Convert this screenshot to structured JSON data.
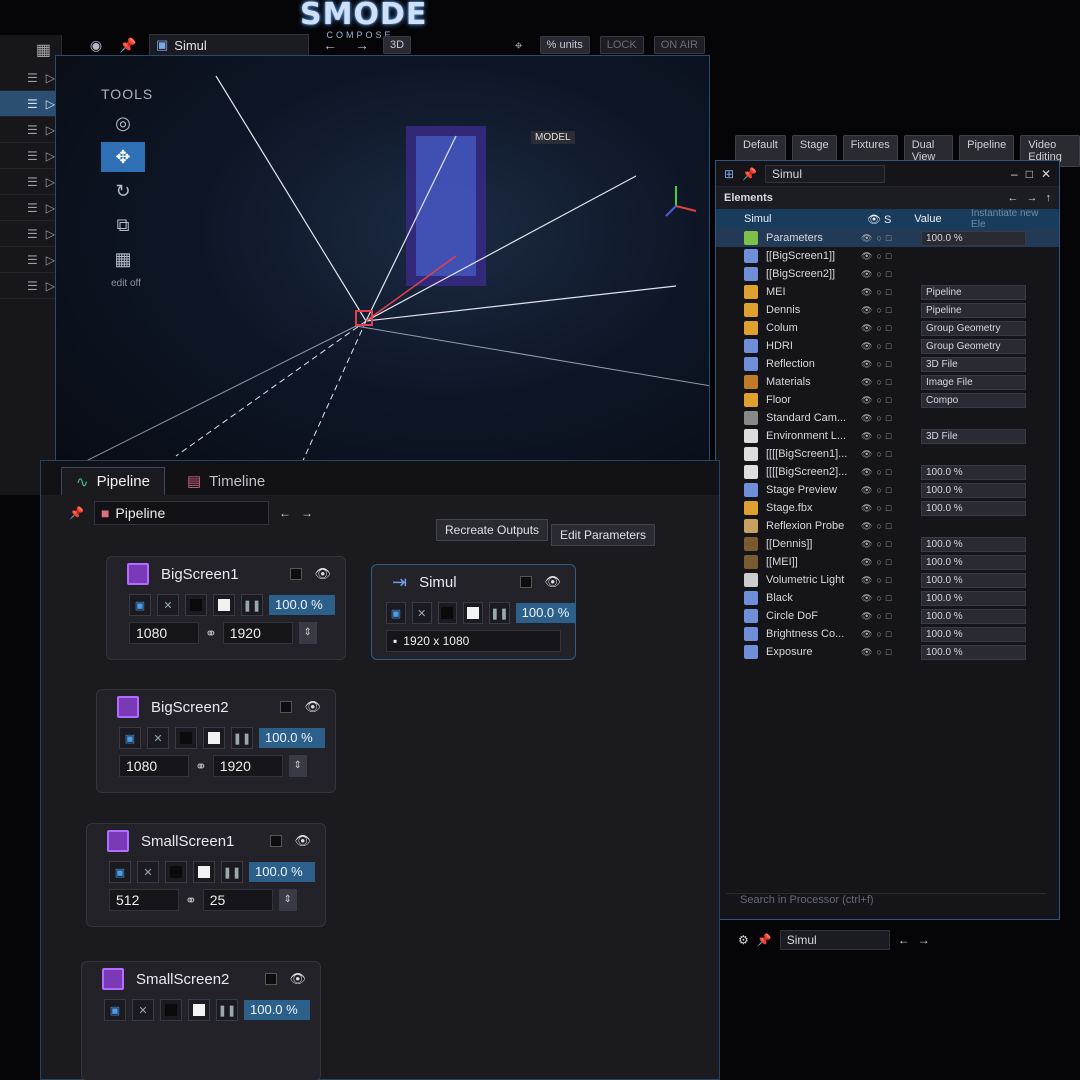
{
  "logo": {
    "line1": "SMODE",
    "line2": "COMPOSE"
  },
  "viewport": {
    "title": "Simul",
    "units": "% units",
    "lock": "LOCK",
    "on_air": "ON AIR",
    "model": "MODEL",
    "threed": "3D",
    "tools": {
      "title": "TOOLS",
      "edit_off": "edit off"
    }
  },
  "layout_tabs": [
    "Default",
    "Stage",
    "Fixtures",
    "Dual View",
    "Pipeline",
    "Video Editing"
  ],
  "elements": {
    "title": "Simul",
    "header": "Elements",
    "search_placeholder": "Instantiate new Ele",
    "col_value": "Value",
    "root": "Simul",
    "rows": [
      {
        "name": "Parameters",
        "value": "100.0 %",
        "color": "#7cc24a"
      },
      {
        "name": "[[BigScreen1]]",
        "value": "",
        "color": "#6f8fd8"
      },
      {
        "name": "[[BigScreen2]]",
        "value": "",
        "color": "#6f8fd8"
      },
      {
        "name": "MEI",
        "value": "Pipeline",
        "color": "#e0a030"
      },
      {
        "name": "Dennis",
        "value": "Pipeline",
        "color": "#e0a030"
      },
      {
        "name": "Colum",
        "value": "Group Geometry",
        "color": "#e0a030"
      },
      {
        "name": "HDRI",
        "value": "Group Geometry",
        "color": "#6f8fd8"
      },
      {
        "name": "Reflection",
        "value": "3D File",
        "color": "#6f8fd8"
      },
      {
        "name": "Materials",
        "value": "Image File",
        "color": "#c07a28"
      },
      {
        "name": "Floor",
        "value": "Compo",
        "color": "#e0a030"
      },
      {
        "name": "Standard Cam...",
        "value": "",
        "color": "#888888"
      },
      {
        "name": "Environment L...",
        "value": "3D File",
        "color": "#dddddd"
      },
      {
        "name": "[[[[BigScreen1]...",
        "value": "",
        "color": "#dddddd"
      },
      {
        "name": "[[[[BigScreen2]...",
        "value": "100.0 %",
        "color": "#dddddd"
      },
      {
        "name": "Stage Preview",
        "value": "100.0 %",
        "color": "#6f8fd8"
      },
      {
        "name": "Stage.fbx",
        "value": "100.0 %",
        "color": "#e0a030"
      },
      {
        "name": "Reflexion Probe",
        "value": "",
        "color": "#c8a060"
      },
      {
        "name": "[[Dennis]]",
        "value": "100.0 %",
        "color": "#7a5a30"
      },
      {
        "name": "[[MEI]]",
        "value": "100.0 %",
        "color": "#7a5a30"
      },
      {
        "name": "Volumetric Light",
        "value": "100.0 %",
        "color": "#cccccc"
      },
      {
        "name": "Black",
        "value": "100.0 %",
        "color": "#6f8fd8"
      },
      {
        "name": "Circle DoF",
        "value": "100.0 %",
        "color": "#6f8fd8"
      },
      {
        "name": "Brightness Co...",
        "value": "100.0 %",
        "color": "#6f8fd8"
      },
      {
        "name": "Exposure",
        "value": "100.0 %",
        "color": "#6f8fd8"
      }
    ],
    "search": "Search in Processor (ctrl+f)",
    "bottom_title": "Simul"
  },
  "pipeline": {
    "tabs": [
      "Pipeline",
      "Timeline"
    ],
    "name": "Pipeline",
    "recreate": "Recreate Outputs",
    "edit_params": "Edit Parameters",
    "nodes": [
      {
        "name": "BigScreen1",
        "pct": "100.0 %",
        "w": "1080",
        "h": "1920"
      },
      {
        "name": "BigScreen2",
        "pct": "100.0 %",
        "w": "1080",
        "h": "1920"
      },
      {
        "name": "SmallScreen1",
        "pct": "100.0 %",
        "w": "512",
        "h": "25"
      },
      {
        "name": "SmallScreen2",
        "pct": "100.0 %"
      }
    ],
    "output": {
      "name": "Simul",
      "pct": "100.0 %",
      "res": "1920 x 1080"
    }
  },
  "colors": {
    "accent": "#2f6fb5",
    "pct_bg": "#2c5f8a",
    "border": "#2d5680"
  }
}
